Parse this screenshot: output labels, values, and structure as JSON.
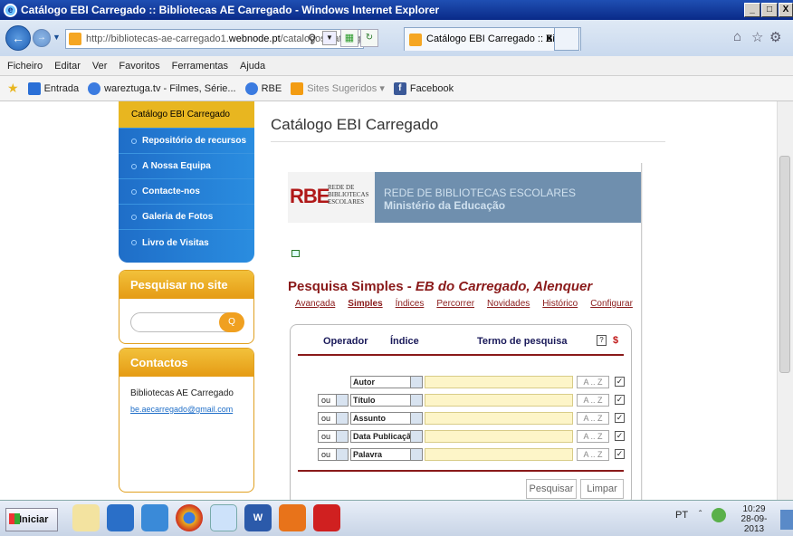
{
  "window": {
    "title": "Catálogo EBI Carregado :: Bibliotecas AE Carregado - Windows Internet Explorer",
    "min": "_",
    "max": "□",
    "close": "X"
  },
  "address": {
    "prefix": "http://bibliotecas-ae-carregado1.",
    "domain": "webnode.pt",
    "suffix": "/catalogos/catalogo-"
  },
  "tab": {
    "label": "Catálogo EBI Carregado :: Bi...",
    "close": "X"
  },
  "menu": [
    "Ficheiro",
    "Editar",
    "Ver",
    "Favoritos",
    "Ferramentas",
    "Ajuda"
  ],
  "favorites": [
    {
      "label": "Entrada",
      "color": "#2a6fd6"
    },
    {
      "label": "wareztuga.tv - Filmes, Série...",
      "color": "#3b7be0"
    },
    {
      "label": "RBE",
      "color": "#3b7be0"
    },
    {
      "label": "Sites Sugeridos ▾",
      "color": "#f39c12"
    },
    {
      "label": "Facebook",
      "color": "#3b5998"
    }
  ],
  "sidebar": {
    "active": "Catálogo EBI Carregado",
    "items": [
      "Repositório de recursos",
      "A Nossa Equipa",
      "Contacte-nos",
      "Galeria de Fotos",
      "Livro de Visitas"
    ]
  },
  "search_site": {
    "title": "Pesquisar no site",
    "button": "Q"
  },
  "contacts": {
    "title": "Contactos",
    "name": "Bibliotecas AE Carregado",
    "email": "be.aecarregado@gmail.com"
  },
  "page_title": "Catálogo EBI Carregado",
  "rbe": {
    "logo_letters": "RBE",
    "logo_text_1": "REDE DE",
    "logo_text_2": "BIBLIOTECAS",
    "logo_text_3": "ESCOLARES",
    "banner_1": "REDE DE BIBLIOTECAS ESCOLARES",
    "banner_2": "Ministério da Educação"
  },
  "search": {
    "title_a": "Pesquisa Simples - ",
    "title_b": "EB do Carregado, Alenquer",
    "tabs": [
      "Avançada",
      "Simples",
      "Índices",
      "Percorrer",
      "Novidades",
      "Histórico",
      "Configurar"
    ],
    "col_operator": "Operador",
    "col_index": "Índice",
    "col_term": "Termo de pesquisa",
    "help": "?",
    "dollar": "$",
    "rows": [
      {
        "op": "",
        "index": "Autor"
      },
      {
        "op": "ou",
        "index": "Título"
      },
      {
        "op": "ou",
        "index": "Assunto"
      },
      {
        "op": "ou",
        "index": "Data Publicação"
      },
      {
        "op": "ou",
        "index": "Palavra"
      }
    ],
    "az": "A .. Z",
    "check": "✓",
    "btn_search": "Pesquisar",
    "btn_clear": "Limpar"
  },
  "taskbar": {
    "start": "Iniciar",
    "lang": "PT",
    "time": "10:29",
    "date": "28-09-2013"
  }
}
